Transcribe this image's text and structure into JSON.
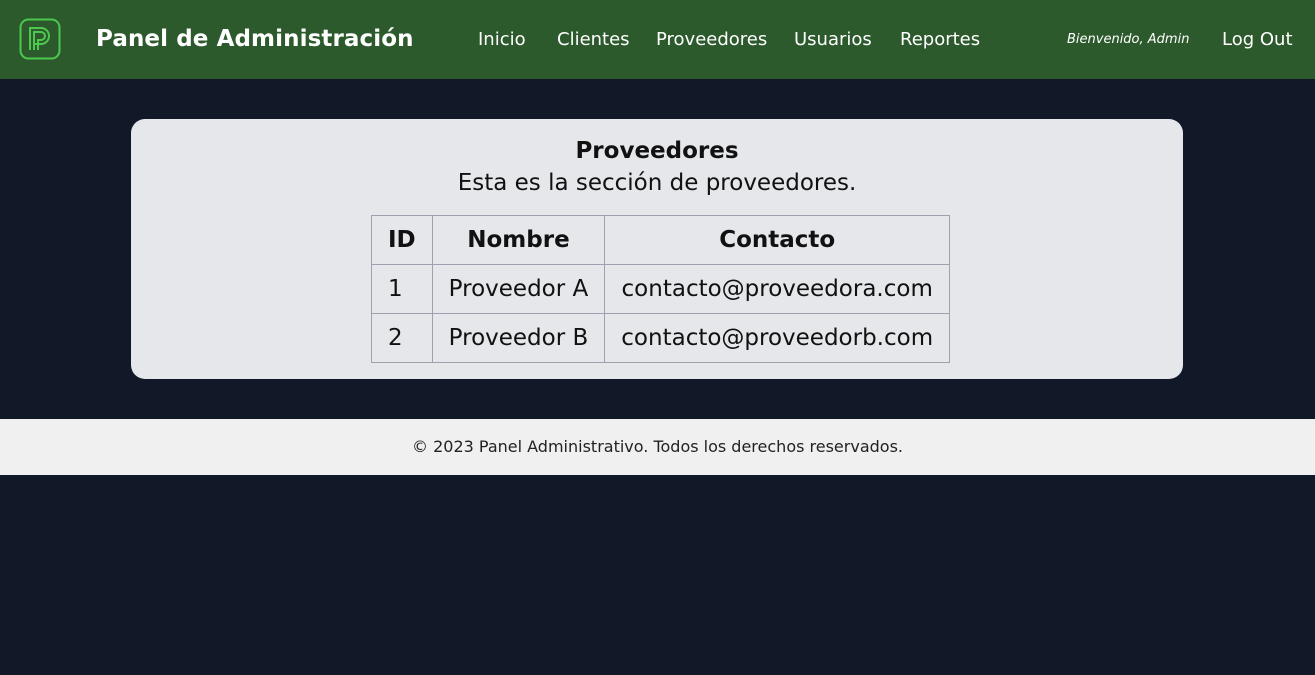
{
  "header": {
    "brand": "Panel de Administración",
    "nav": [
      {
        "label": "Inicio"
      },
      {
        "label": "Clientes"
      },
      {
        "label": "Proveedores"
      },
      {
        "label": "Usuarios"
      },
      {
        "label": "Reportes"
      }
    ],
    "welcome": "Bienvenido, Admin",
    "logout": "Log Out",
    "logo_icon": "p-logo-icon",
    "colors": {
      "bar": "#2d5a2d",
      "logo": "#4cc94c"
    }
  },
  "main": {
    "title": "Proveedores",
    "subtitle": "Esta es la sección de proveedores.",
    "table": {
      "headers": [
        "ID",
        "Nombre",
        "Contacto"
      ],
      "rows": [
        [
          "1",
          "Proveedor A",
          "contacto@proveedora.com"
        ],
        [
          "2",
          "Proveedor B",
          "contacto@proveedorb.com"
        ]
      ]
    }
  },
  "footer": {
    "text": "© 2023 Panel Administrativo. Todos los derechos reservados."
  },
  "colors": {
    "page_background": "#111827",
    "card_background": "#e5e7eb",
    "footer_background": "#f0f0f0"
  }
}
